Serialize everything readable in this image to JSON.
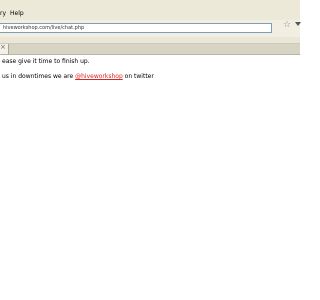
{
  "menu": {
    "items": [
      "ry",
      "Help"
    ]
  },
  "address_bar": {
    "url": "hiveworkshop.com/live/chat.php"
  },
  "content": {
    "line1": "ease give it time to finish up.",
    "line2_prefix": "us in downtimes we are ",
    "twitter_handle": "@hiveworkshop",
    "line2_suffix": " on twitter"
  },
  "icons": {
    "bookmark_star": "star-icon",
    "url_dropdown": "dropdown-arrow-icon",
    "tab_close": "close-icon"
  }
}
